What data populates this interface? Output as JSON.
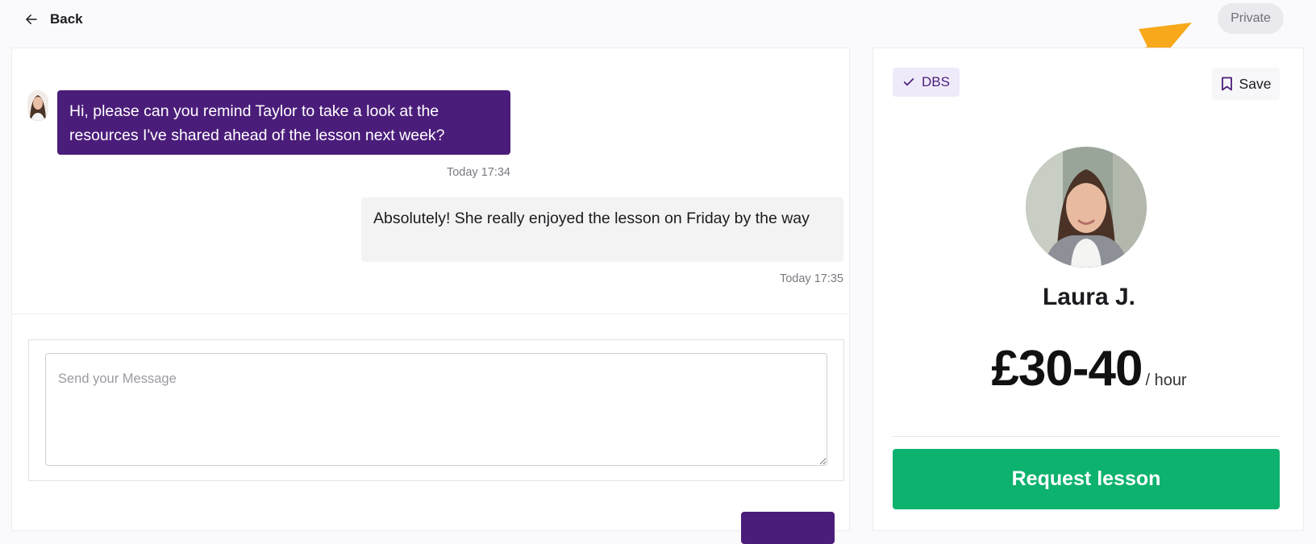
{
  "nav": {
    "back_label": "Back"
  },
  "visibility": {
    "label": "Private"
  },
  "chat": {
    "messages": [
      {
        "direction": "incoming",
        "text": "Hi, please can you remind Taylor to take a look at the resources I've shared ahead of the lesson next week?",
        "time": "Today 17:34"
      },
      {
        "direction": "outgoing",
        "text": "Absolutely! She really enjoyed the lesson on Friday by the way",
        "time": "Today 17:35"
      }
    ],
    "compose": {
      "placeholder": "Send your Message",
      "value": ""
    }
  },
  "profile": {
    "badge": "DBS",
    "save_label": "Save",
    "name": "Laura J.",
    "price": "£30-40",
    "price_unit": "/ hour",
    "cta_label": "Request lesson"
  },
  "colors": {
    "brand_purple": "#4b1d7a",
    "cta_green": "#0db26e",
    "annotation_orange": "#f7a81b"
  },
  "icons": [
    "arrow-left-icon",
    "check-icon",
    "bookmark-icon",
    "annotation-arrow"
  ]
}
